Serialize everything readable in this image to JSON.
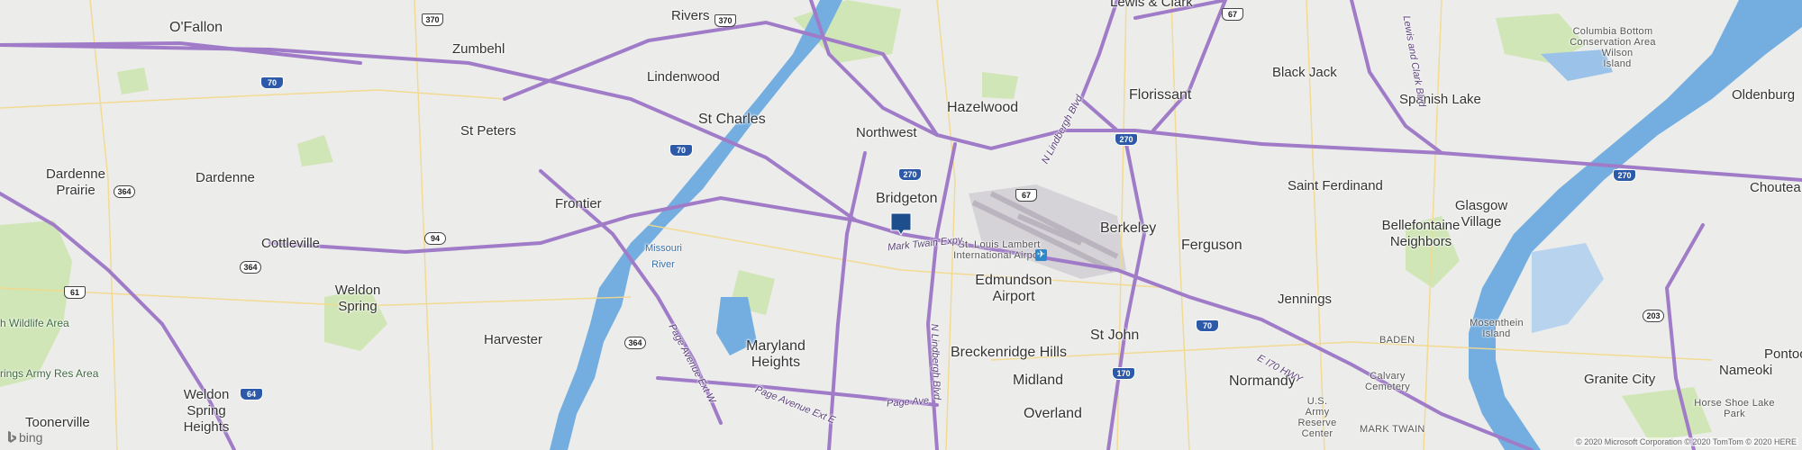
{
  "map": {
    "provider_logo": "bing",
    "attribution": "© 2020 Microsoft Corporation © 2020 TomTom © 2020 HERE",
    "marker_color": "#1f4e8c",
    "colors": {
      "water": "#6fa6dc",
      "freeway": "#a07cc8",
      "park": "#c6e3a7",
      "land": "#ececea"
    },
    "places": {
      "ofallon": "O'Fallon",
      "zumbehl": "Zumbehl",
      "rivers": "Rivers",
      "lewis_clark": "Lewis & Clark",
      "lindenwood": "Lindenwood",
      "st_charles": "St Charles",
      "st_peters": "St Peters",
      "hazelwood": "Hazelwood",
      "northwest": "Northwest",
      "florissant": "Florissant",
      "black_jack": "Black Jack",
      "spanish_lake": "Spanish Lake",
      "oldenburg": "Oldenburg",
      "dardenne_prairie": "Dardenne Prairie",
      "dardenne": "Dardenne",
      "frontier": "Frontier",
      "bridgeton": "Bridgeton",
      "berkeley": "Berkeley",
      "ferguson": "Ferguson",
      "saint_ferdinand": "Saint Ferdinand",
      "glasgow_village": "Glasgow Village",
      "bellefontaine_neighbors": "Bellefontaine Neighbors",
      "choutea": "Choutea",
      "cottleville": "Cottleville",
      "weldon_spring": "Weldon Spring",
      "edmundson_airport": "Edmundson Airport",
      "jennings": "Jennings",
      "harvester": "Harvester",
      "maryland_heights": "Maryland Heights",
      "breckenridge_hills": "Breckenridge Hills",
      "st_john": "St John",
      "pontoo": "Pontoo",
      "weldon_spring_heights": "Weldon Spring Heights",
      "midland": "Midland",
      "normandy": "Normandy",
      "granite_city": "Granite City",
      "nameoki": "Nameoki",
      "overland": "Overland",
      "toonerville": "Toonerville",
      "wildlife_area": "h Wildlife Area",
      "army_res_area": "rings Army Res Area"
    },
    "small_labels": {
      "columbia_bottom": "Columbia Bottom Conservation Area",
      "wilson_island": "Wilson Island",
      "lambert_airport": "St. Louis Lambert International Airport",
      "missouri_river": "Missouri River",
      "mosenthein_island": "Mosenthein Island",
      "baden": "BADEN",
      "calvary_cemetery": "Calvary Cemetery",
      "us_army_reserve": "U.S. Army Reserve Center",
      "mark_twain": "MARK TWAIN",
      "horse_shoe_lake": "Horse Shoe Lake Park"
    },
    "roads": {
      "mark_twain_expy": "Mark Twain Expy",
      "n_lindbergh_blvd_north": "N Lindbergh Blvd",
      "n_lindbergh_blvd_south": "N Lindbergh Blvd",
      "lewis_clark_blvd": "Lewis and Clark Blvd",
      "page_ave_ext_w": "Page Avenue Ext W",
      "page_ave_ext_e": "Page Avenue Ext E",
      "page_ave": "Page Ave",
      "e_i70_hwy": "E I70 HWY"
    },
    "shields": {
      "i370": "370",
      "i370b": "370",
      "us67_top": "67",
      "i70_w": "70",
      "i270_n": "270",
      "i70_stc": "70",
      "i270_c": "270",
      "st364": "364",
      "us67_c": "67",
      "i270_e": "270",
      "i270_far": "270",
      "st94": "94",
      "st364b": "364",
      "us61": "61",
      "i70_e": "70",
      "i170": "170",
      "st364c": "364",
      "i64": "64",
      "st203": "203"
    }
  }
}
